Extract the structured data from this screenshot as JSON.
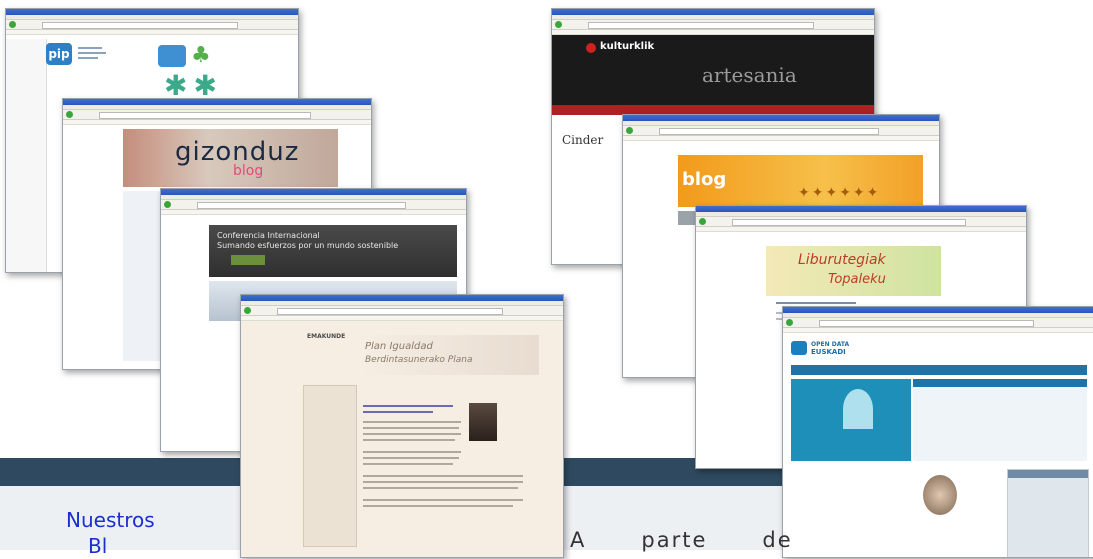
{
  "screens": {
    "pip": {
      "logo_text": "pip"
    },
    "gizonduz": {
      "title": "gizonduz",
      "subtitle": "blog"
    },
    "conference": {
      "line1": "Conferencia Internacional",
      "line2": "Sumando esfuerzos por un mundo sostenible"
    },
    "emakunde": {
      "brand": "EMAKUNDE",
      "plan_line1": "Plan Igualdad",
      "plan_line2": "Berdintasunerako Plana"
    },
    "kulturklik": {
      "brand": "kulturklik",
      "banner": "artesania",
      "left_title": "Cinder"
    },
    "gazteblog": {
      "title": "blog"
    },
    "liburutegiak": {
      "line1": "Liburutegiak",
      "line2": "Topaleku"
    },
    "irekia": {
      "brand_line1": "OPEN DATA",
      "brand_line2": "EUSKADI"
    }
  },
  "footer": {
    "heading_line1": "Nuestros",
    "heading_line2": "Bl",
    "paragraph_word1": "A",
    "paragraph_word2": "parte",
    "paragraph_word3": "de"
  },
  "colors": {
    "band": "#edf0f3",
    "band_dark": "#2f4a60",
    "heading": "#1a2fd0"
  }
}
